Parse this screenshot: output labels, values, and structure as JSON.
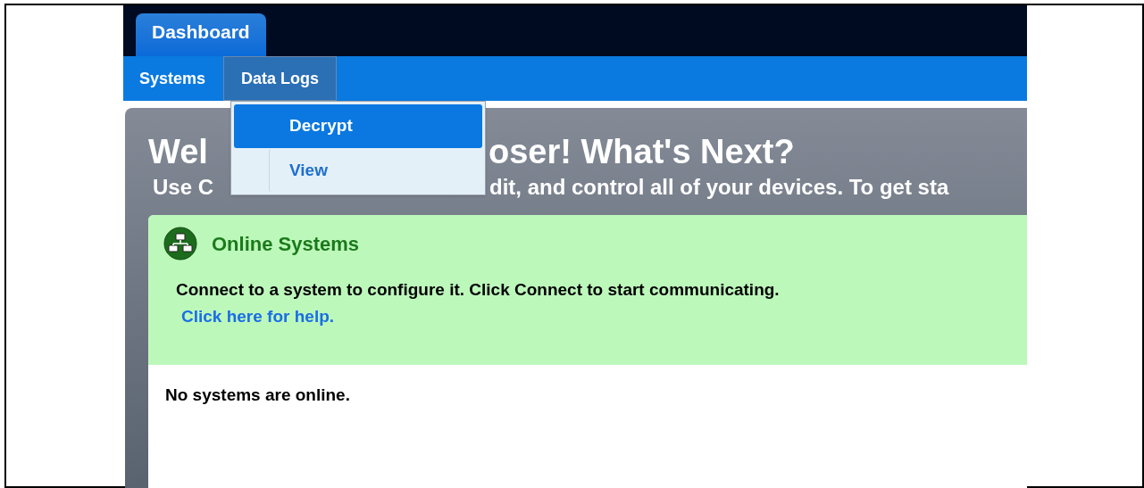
{
  "tabs": [
    {
      "label": "Dashboard",
      "selected": true
    }
  ],
  "nav": [
    {
      "label": "Systems",
      "open": false
    },
    {
      "label": "Data Logs",
      "open": true
    }
  ],
  "dropdown": {
    "items": [
      {
        "label": "Decrypt",
        "selected": true
      },
      {
        "label": "View",
        "selected": false
      }
    ]
  },
  "welcome": {
    "title_parts": [
      "Wel",
      "oser! What's Next?"
    ],
    "subtitle_parts": [
      "Use C",
      "dit, and control all of your devices. To get sta"
    ]
  },
  "online_panel": {
    "title": "Online Systems",
    "description": "Connect to a system to configure it. Click Connect to start communicating.",
    "help_link": "Click here for help.",
    "empty_message": "No systems are online."
  }
}
